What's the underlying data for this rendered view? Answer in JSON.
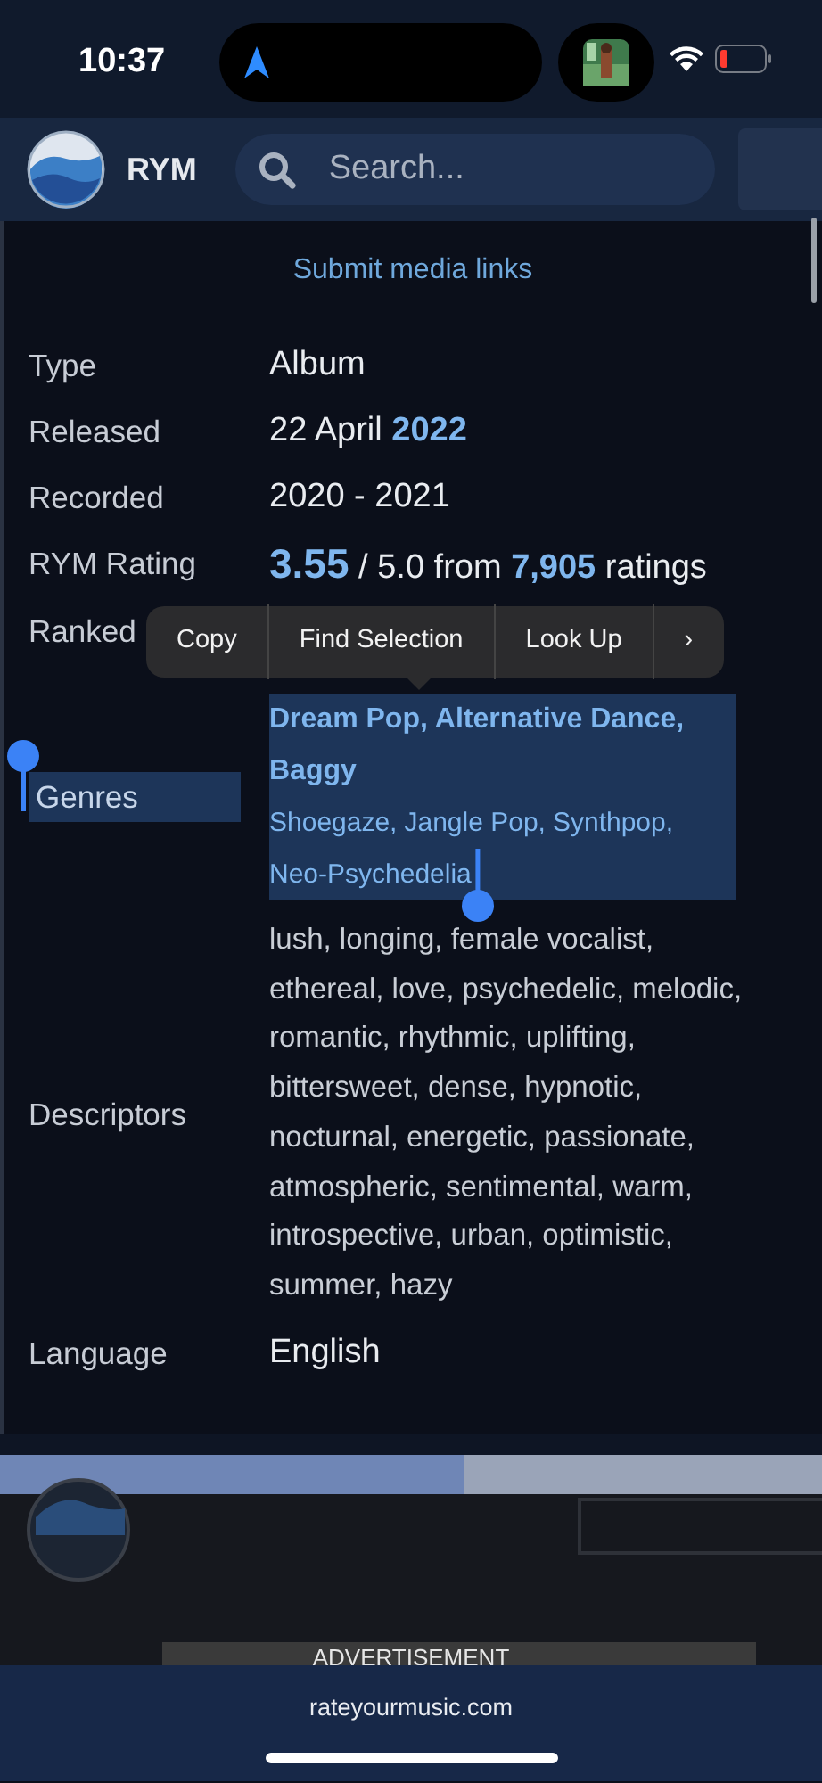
{
  "status_bar": {
    "time": "10:37"
  },
  "header": {
    "logo_text": "RYM",
    "search": {
      "placeholder": "Search..."
    }
  },
  "submit_link": "Submit media links",
  "details": [
    {
      "kind": "text",
      "label": "Type",
      "value": "Album",
      "selected": false
    },
    {
      "kind": "rich",
      "label": "Released",
      "value": "22 April **2022**",
      "selected": false
    },
    {
      "kind": "text",
      "label": "Recorded",
      "value": "2020 - 2021",
      "selected": false
    },
    {
      "kind": "rating",
      "label": "RYM Rating",
      "value": "**3.55** / 5.0 from **7,905** ratings",
      "selected": false
    },
    {
      "kind": "blank",
      "label": "Ranked",
      "selected": false
    },
    {
      "kind": "genres",
      "label": "Genres",
      "primary": [
        "Dream Pop,",
        "Alternative Dance,",
        "Baggy"
      ],
      "secondary": [
        "Shoegaze,",
        "Jangle Pop,",
        "Synthpop,",
        "Neo-Psychedelia"
      ],
      "selected": true
    },
    {
      "kind": "text",
      "label": "Descriptors",
      "value": "lush, longing, female vocalist, ethereal, love, psychedelic, melodic, romantic, rhythmic, uplifting, bittersweet, dense, hypnotic, nocturnal, energetic, passionate, atmospheric, sentimental, warm, introspective, urban, optimistic, summer, hazy",
      "selected": false
    },
    {
      "kind": "text",
      "label": "Language",
      "value": "English",
      "selected": false
    }
  ],
  "context_menu": [
    "Copy",
    "Find Selection",
    "Look Up",
    "›"
  ],
  "ad": {
    "label": "ADVERTISEMENT"
  },
  "browser_bar": {
    "address": "rateyourmusic.com"
  }
}
